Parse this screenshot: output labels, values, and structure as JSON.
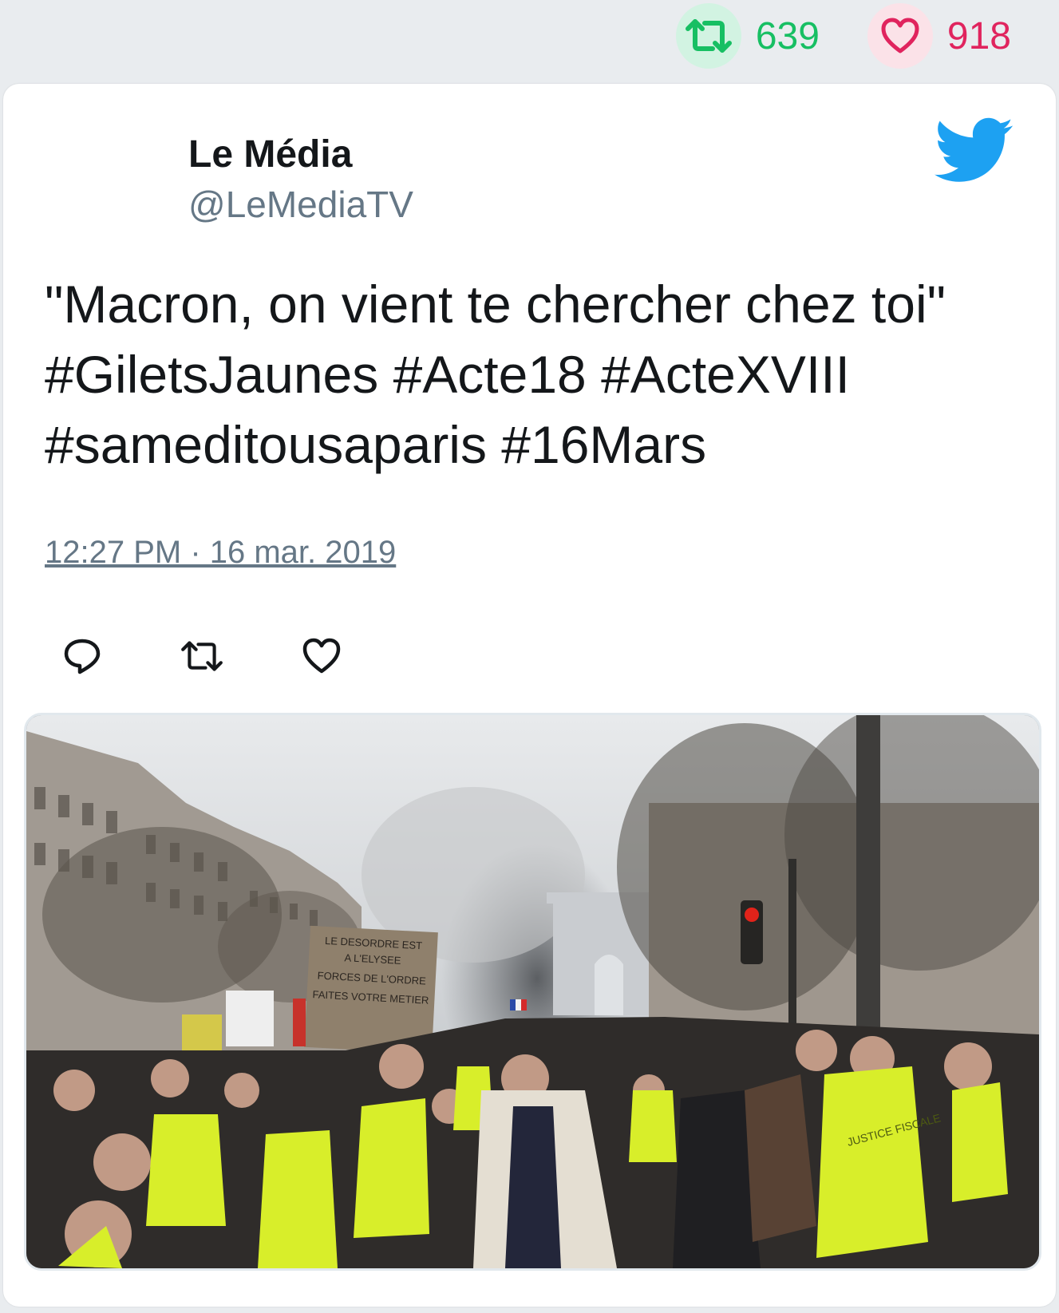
{
  "stats": {
    "retweets": "639",
    "likes": "918",
    "retweet_icon": "retweet-icon",
    "like_icon": "heart-icon"
  },
  "tweet": {
    "author_name": "Le Média",
    "author_handle": "@LeMediaTV",
    "text_lines": [
      "\"Macron, on vient te chercher chez toi\"",
      "#GiletsJaunes #Acte18 #ActeXVIII",
      "#sameditousaparis #16Mars"
    ],
    "timestamp": "12:27 PM · 16 mar. 2019",
    "logo": "twitter-bird-icon"
  },
  "actions": {
    "reply_icon": "reply-icon",
    "retweet_icon": "retweet-icon",
    "like_icon": "heart-icon"
  },
  "media": {
    "sign_lines": [
      "LE DESORDRE EST",
      "A L'ELYSEE",
      "FORCES DE L'ORDRE",
      "FAITES VOTRE METIER"
    ],
    "vest_text": "JUSTICE FISCALE"
  },
  "colors": {
    "retweet_green": "#17bf63",
    "like_red": "#e0245e",
    "twitter_blue": "#1da1f2",
    "vest_yellow": "#d8ee2a"
  }
}
